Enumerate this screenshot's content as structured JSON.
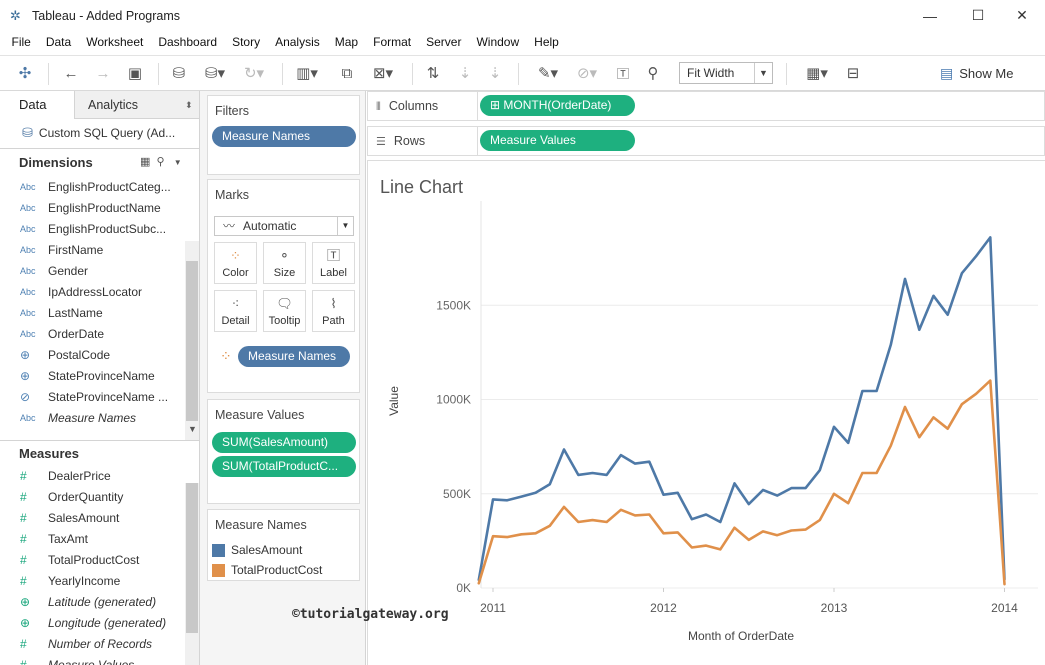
{
  "window": {
    "title": "Tableau - Added Programs"
  },
  "menu": [
    "File",
    "Data",
    "Worksheet",
    "Dashboard",
    "Story",
    "Analysis",
    "Map",
    "Format",
    "Server",
    "Window",
    "Help"
  ],
  "toolbar": {
    "fit": "Fit Width",
    "show_me": "Show Me"
  },
  "data_pane": {
    "tab_data": "Data",
    "tab_analytics": "Analytics",
    "datasource": "Custom SQL Query (Ad...",
    "dimensions_label": "Dimensions",
    "dimensions": [
      {
        "type": "Abc",
        "name": "EnglishProductCateg..."
      },
      {
        "type": "Abc",
        "name": "EnglishProductName"
      },
      {
        "type": "Abc",
        "name": "EnglishProductSubc..."
      },
      {
        "type": "Abc",
        "name": "FirstName"
      },
      {
        "type": "Abc",
        "name": "Gender"
      },
      {
        "type": "Abc",
        "name": "IpAddressLocator"
      },
      {
        "type": "Abc",
        "name": "LastName"
      },
      {
        "type": "Abc",
        "name": "OrderDate"
      },
      {
        "type": "globe",
        "name": "PostalCode"
      },
      {
        "type": "globe",
        "name": "StateProvinceName"
      },
      {
        "type": "link",
        "name": "StateProvinceName ..."
      },
      {
        "type": "Abc",
        "name": "Measure Names"
      }
    ],
    "measures_label": "Measures",
    "measures": [
      {
        "type": "#",
        "name": "DealerPrice"
      },
      {
        "type": "#",
        "name": "OrderQuantity"
      },
      {
        "type": "#",
        "name": "SalesAmount"
      },
      {
        "type": "#",
        "name": "TaxAmt"
      },
      {
        "type": "#",
        "name": "TotalProductCost"
      },
      {
        "type": "#",
        "name": "YearlyIncome"
      },
      {
        "type": "globe",
        "name": "Latitude (generated)"
      },
      {
        "type": "globe",
        "name": "Longitude (generated)"
      },
      {
        "type": "#",
        "name": "Number of Records"
      },
      {
        "type": "#",
        "name": "Measure Values"
      }
    ]
  },
  "filters": {
    "title": "Filters",
    "pill": "Measure Names"
  },
  "marks": {
    "title": "Marks",
    "type": "Automatic",
    "buttons": [
      "Color",
      "Size",
      "Label",
      "Detail",
      "Tooltip",
      "Path"
    ],
    "color_pill": "Measure Names"
  },
  "measure_values": {
    "title": "Measure Values",
    "pills": [
      "SUM(SalesAmount)",
      "SUM(TotalProductC..."
    ]
  },
  "legend": {
    "title": "Measure Names",
    "items": [
      {
        "name": "SalesAmount",
        "color": "#4e79a7"
      },
      {
        "name": "TotalProductCost",
        "color": "#e0904a"
      }
    ]
  },
  "shelves": {
    "columns_label": "Columns",
    "columns_pill": "MONTH(OrderDate)",
    "rows_label": "Rows",
    "rows_pill": "Measure Values"
  },
  "watermark": "©tutorialgateway.org",
  "chart_data": {
    "type": "line",
    "title": "Line Chart",
    "xlabel": "Month of OrderDate",
    "ylabel": "Value",
    "x_ticks": [
      "2011",
      "2012",
      "2013",
      "2014"
    ],
    "y_ticks": [
      "0K",
      "500K",
      "1000K",
      "1500K"
    ],
    "ylim": [
      0,
      2000000
    ],
    "x": [
      "2010-12",
      "2011-01",
      "2011-02",
      "2011-03",
      "2011-04",
      "2011-05",
      "2011-06",
      "2011-07",
      "2011-08",
      "2011-09",
      "2011-10",
      "2011-11",
      "2011-12",
      "2012-01",
      "2012-02",
      "2012-03",
      "2012-04",
      "2012-05",
      "2012-06",
      "2012-07",
      "2012-08",
      "2012-09",
      "2012-10",
      "2012-11",
      "2012-12",
      "2013-01",
      "2013-02",
      "2013-03",
      "2013-04",
      "2013-05",
      "2013-06",
      "2013-07",
      "2013-08",
      "2013-09",
      "2013-10",
      "2013-11",
      "2013-12",
      "2014-01"
    ],
    "series": [
      {
        "name": "SalesAmount",
        "color": "#4e79a7",
        "values": [
          43000,
          470000,
          465000,
          485000,
          505000,
          550000,
          735000,
          600000,
          610000,
          600000,
          705000,
          660000,
          670000,
          495000,
          505000,
          365000,
          390000,
          350000,
          555000,
          445000,
          520000,
          490000,
          530000,
          530000,
          625000,
          855000,
          770000,
          1045000,
          1045000,
          1290000,
          1640000,
          1370000,
          1550000,
          1450000,
          1670000,
          1760000,
          1860000,
          45000
        ]
      },
      {
        "name": "TotalProductCost",
        "color": "#e0904a",
        "values": [
          25000,
          275000,
          270000,
          285000,
          290000,
          330000,
          430000,
          350000,
          360000,
          350000,
          415000,
          385000,
          390000,
          290000,
          295000,
          215000,
          225000,
          205000,
          320000,
          255000,
          300000,
          280000,
          305000,
          310000,
          360000,
          500000,
          450000,
          610000,
          610000,
          755000,
          960000,
          800000,
          905000,
          845000,
          975000,
          1030000,
          1100000,
          20000
        ]
      }
    ]
  }
}
